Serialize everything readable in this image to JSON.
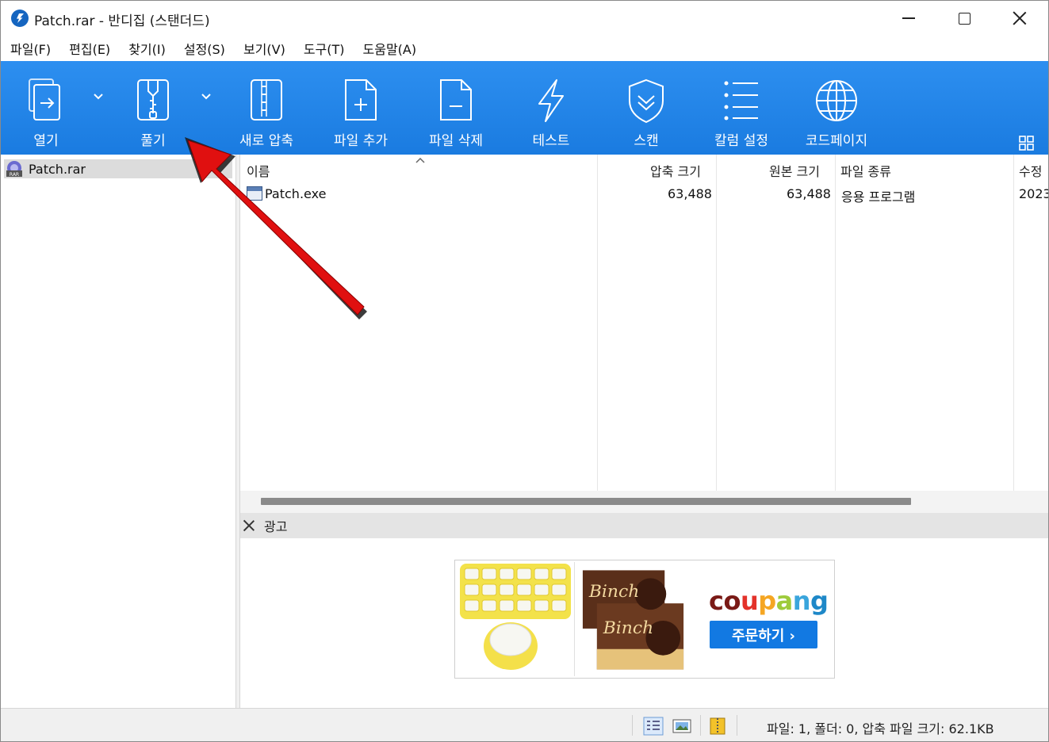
{
  "window": {
    "title": "Patch.rar - 반디집 (스탠더드)"
  },
  "menu": [
    {
      "label": "파일(F)"
    },
    {
      "label": "편집(E)"
    },
    {
      "label": "찾기(I)"
    },
    {
      "label": "설정(S)"
    },
    {
      "label": "보기(V)"
    },
    {
      "label": "도구(T)"
    },
    {
      "label": "도움말(A)"
    }
  ],
  "toolbar": {
    "open_label": "열기",
    "extract_label": "풀기",
    "new_archive_label": "새로 압축",
    "add_file_label": "파일 추가",
    "delete_file_label": "파일 삭제",
    "test_label": "테스트",
    "scan_label": "스캔",
    "columns_label": "칼럼 설정",
    "codepage_label": "코드페이지",
    "accent_color": "#2488ea"
  },
  "tree": {
    "archive_name": "Patch.rar"
  },
  "filelist": {
    "columns": [
      "이름",
      "압축 크기",
      "원본 크기",
      "파일 종류",
      "수정"
    ],
    "rows": [
      {
        "name": "Patch.exe",
        "packed": "63,488",
        "size": "63,488",
        "type": "응용 프로그램",
        "modified": "2023"
      }
    ]
  },
  "ad": {
    "label": "광고",
    "brand": "coupang",
    "cta": "주문하기 ›"
  },
  "status": {
    "text": "파일: 1, 폴더: 0, 압축 파일 크기: 62.1KB"
  },
  "annotation": {
    "arrow_color": "#e01010"
  }
}
